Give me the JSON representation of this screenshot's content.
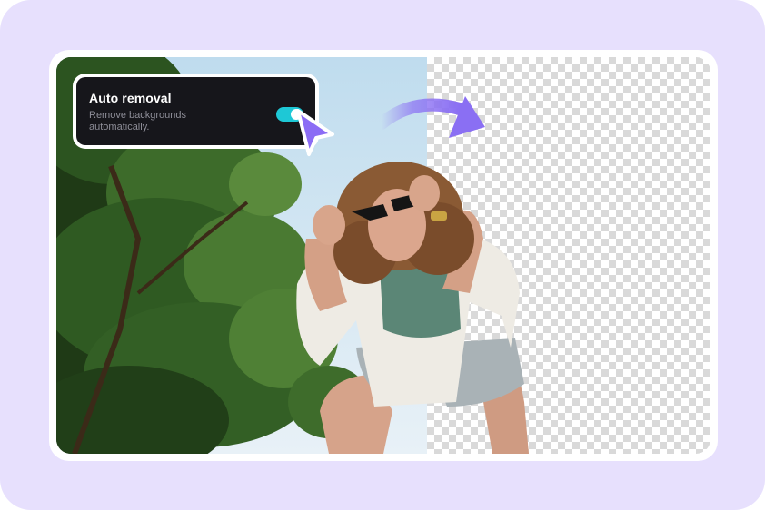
{
  "auto_removal": {
    "title": "Auto removal",
    "description": "Remove backgrounds automatically.",
    "enabled": true
  },
  "icons": {
    "toggle": "toggle-switch-icon",
    "cursor": "mouse-pointer-icon",
    "arrow": "curved-arrow-icon"
  },
  "colors": {
    "background": "#e7e0fd",
    "toggle_on": "#1ec8d6",
    "cursor": "#8b6cf5",
    "arrow": "#8a6ff3"
  }
}
